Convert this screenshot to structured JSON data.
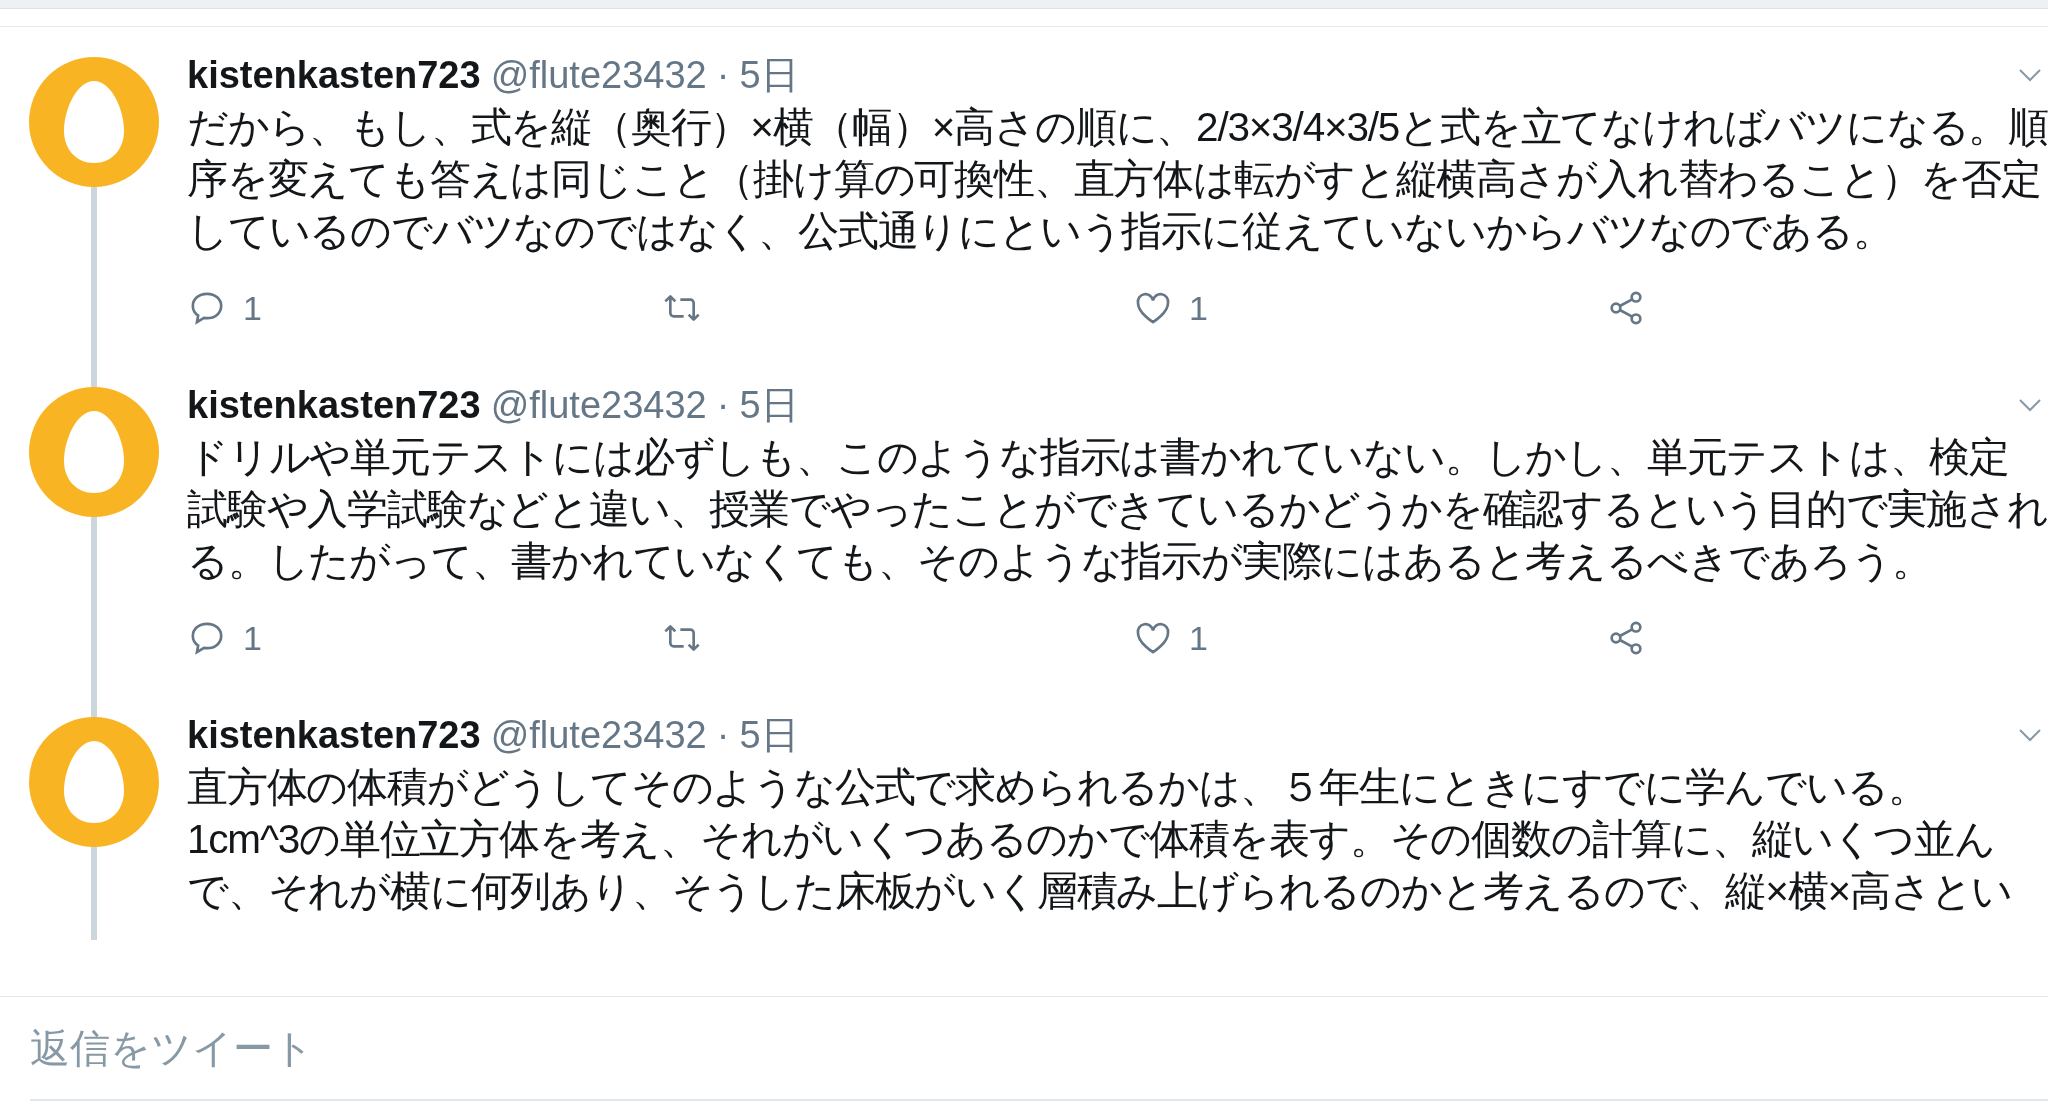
{
  "tweets": [
    {
      "name": "kistenkasten723",
      "handle": "@flute23432",
      "separator": "·",
      "time": "5日",
      "text": "だから、もし、式を縦（奥行）×横（幅）×高さの順に、2/3×3/4×3/5と式を立てなければバツになる。順序を変えても答えは同じこと（掛け算の可換性、直方体は転がすと縦横高さが入れ替わること）を否定しているのでバツなのではなく、公式通りにという指示に従えていないからバツなのである。",
      "actions": {
        "replies": "1",
        "likes": "1"
      }
    },
    {
      "name": "kistenkasten723",
      "handle": "@flute23432",
      "separator": "·",
      "time": "5日",
      "text": "ドリルや単元テストには必ずしも、このような指示は書かれていない。しかし、単元テストは、検定試験や入学試験などと違い、授業でやったことができているかどうかを確認するという目的で実施される。したがって、書かれていなくても、そのような指示が実際にはあると考えるべきであろう。",
      "actions": {
        "replies": "1",
        "likes": "1"
      }
    },
    {
      "name": "kistenkasten723",
      "handle": "@flute23432",
      "separator": "·",
      "time": "5日",
      "text": "直方体の体積がどうしてそのような公式で求められるかは、５年生にときにすでに学んでいる。\n1cm^3の単位立方体を考え、それがいくつあるのかで体積を表す。その個数の計算に、縦いくつ並んで、それが横に何列あり、そうした床板がいく層積み上げられるのかと考えるので、縦×横×高さとい"
    }
  ],
  "reply_box": {
    "placeholder": "返信をツイート"
  }
}
